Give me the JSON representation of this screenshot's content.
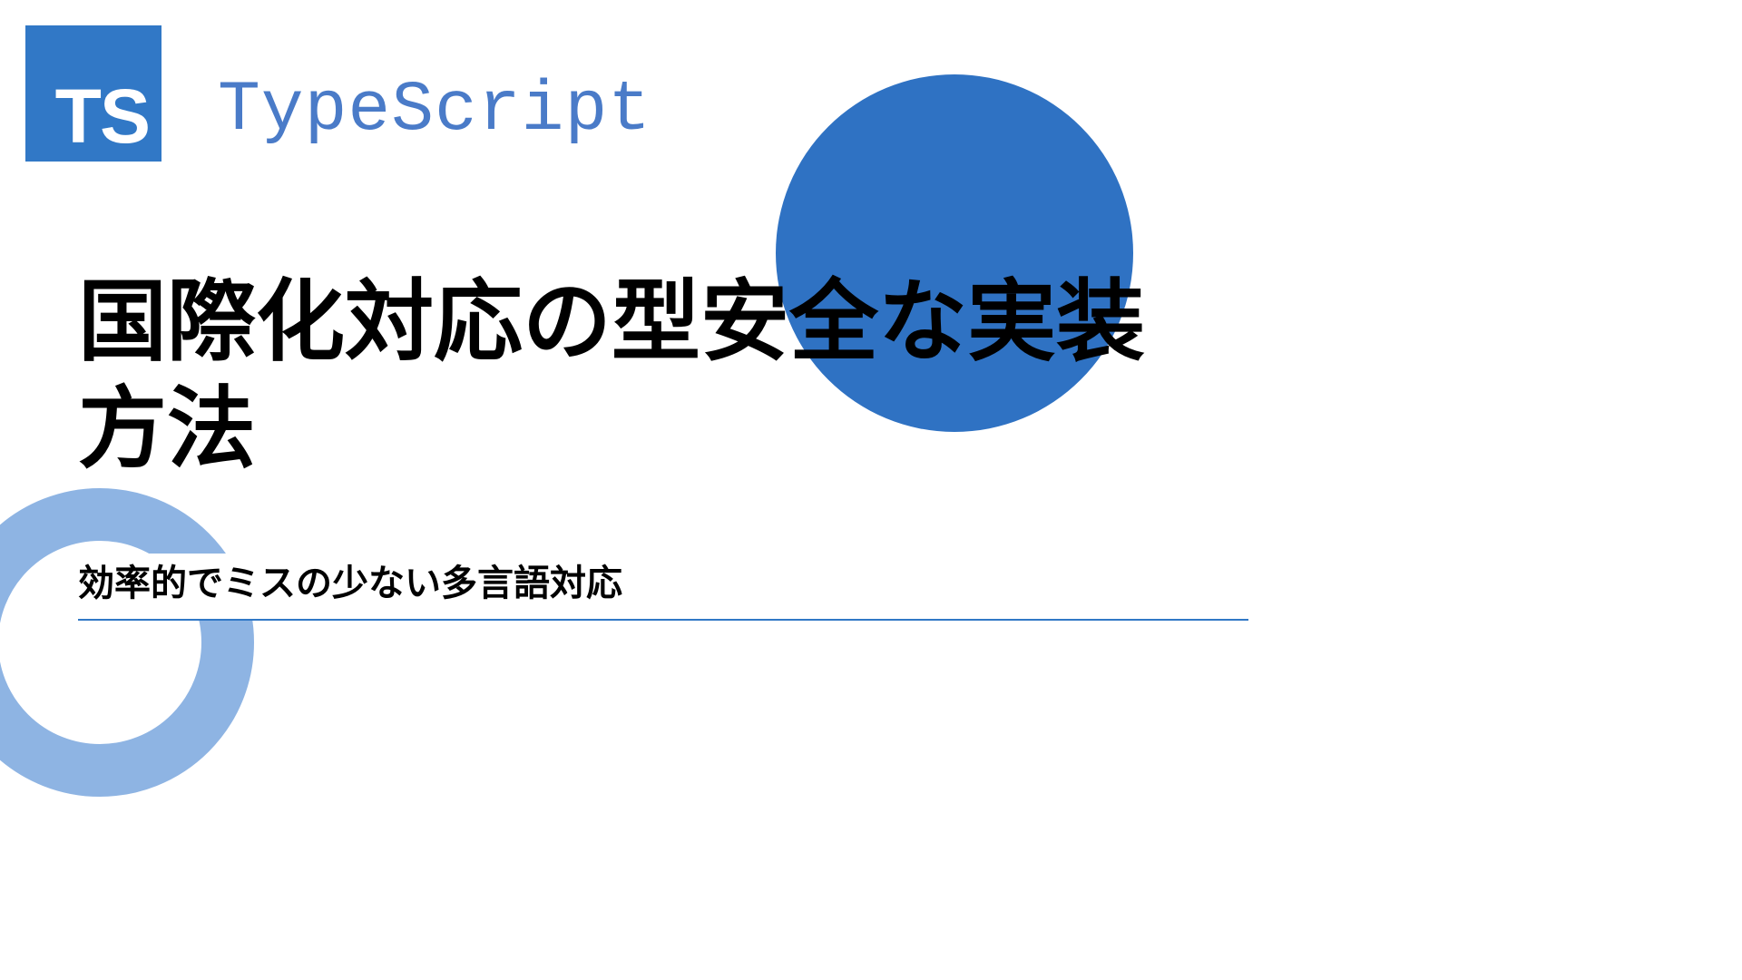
{
  "logo": {
    "text": "TS",
    "brand": "TypeScript"
  },
  "title": "国際化対応の型安全な実装方法",
  "subtitle": "効率的でミスの少ない多言語対応"
}
